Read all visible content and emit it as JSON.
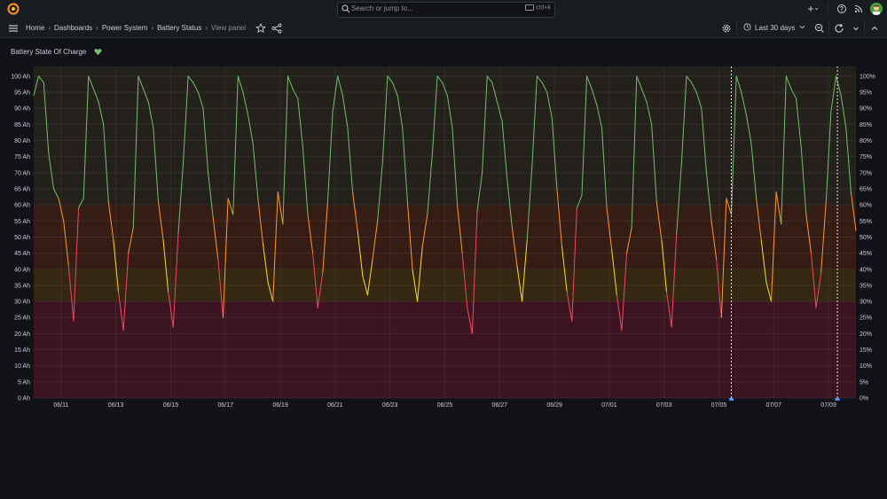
{
  "app": {
    "title": "Grafana"
  },
  "search": {
    "placeholder": "Search or jump to...",
    "shortcut": "ctrl+k"
  },
  "breadcrumb": {
    "items": [
      "Home",
      "Dashboards",
      "Power System",
      "Battery Status"
    ],
    "current": "View panel"
  },
  "toolbar": {
    "time_range": "Last 30 days"
  },
  "panel": {
    "title": "Battery State Of Charge",
    "health_icon": "heart-icon",
    "health_color": "#73bf69"
  },
  "chart_data": {
    "type": "line",
    "series": [
      {
        "values": [
          94,
          100,
          98,
          76,
          65,
          62,
          55,
          41,
          24,
          59,
          62,
          100,
          96,
          92,
          85,
          61,
          49,
          33,
          21,
          45,
          53,
          100,
          96,
          92,
          84,
          61,
          49,
          33,
          22,
          51,
          73,
          100,
          98,
          95,
          90,
          70,
          56,
          43,
          25,
          62,
          57,
          100,
          95,
          88,
          79,
          62,
          48,
          36,
          30,
          64,
          54,
          100,
          96,
          93,
          78,
          57,
          45,
          28,
          39,
          61,
          89,
          100,
          94,
          84,
          64,
          52,
          38,
          32,
          43,
          55,
          73,
          100,
          98,
          94,
          84,
          61,
          40,
          30,
          47,
          57,
          76,
          100,
          98,
          94,
          84,
          60,
          45,
          28,
          20,
          58,
          70,
          100,
          98,
          92,
          86,
          68,
          53,
          41,
          30,
          49,
          72,
          100,
          98,
          95,
          87,
          65,
          47,
          33,
          24,
          59,
          63,
          100,
          96,
          91,
          84,
          59,
          46,
          32,
          21,
          45,
          53,
          100,
          96,
          92,
          85,
          61,
          49,
          33,
          22,
          51,
          73,
          100,
          98,
          95,
          90,
          70,
          55,
          43,
          25,
          62,
          57,
          100,
          95,
          88,
          79,
          62,
          49,
          36,
          30,
          64,
          54,
          100,
          96,
          93,
          78,
          57,
          45,
          28,
          39,
          61,
          89,
          100,
          94,
          84,
          64,
          52
        ]
      }
    ],
    "x_range": [
      "06/10",
      "07/10"
    ],
    "x_ticks": [
      "06/11",
      "06/13",
      "06/15",
      "06/17",
      "06/19",
      "06/21",
      "06/23",
      "06/25",
      "06/27",
      "06/29",
      "07/01",
      "07/03",
      "07/05",
      "07/07",
      "07/09"
    ],
    "y_left_ticks": [
      "0 Ah",
      "5 Ah",
      "10 Ah",
      "15 Ah",
      "20 Ah",
      "25 Ah",
      "30 Ah",
      "35 Ah",
      "40 Ah",
      "45 Ah",
      "50 Ah",
      "55 Ah",
      "60 Ah",
      "65 Ah",
      "70 Ah",
      "75 Ah",
      "80 Ah",
      "85 Ah",
      "90 Ah",
      "95 Ah",
      "100 Ah"
    ],
    "y_right_ticks": [
      "0%",
      "5%",
      "10%",
      "15%",
      "20%",
      "25%",
      "30%",
      "35%",
      "40%",
      "45%",
      "50%",
      "55%",
      "60%",
      "65%",
      "70%",
      "75%",
      "80%",
      "85%",
      "90%",
      "95%",
      "100%"
    ],
    "ylim": [
      0,
      103
    ],
    "bands": [
      {
        "from": 0,
        "to": 30,
        "color": "#3d1422"
      },
      {
        "from": 30,
        "to": 40,
        "color": "#352712"
      },
      {
        "from": 40,
        "to": 60,
        "color": "#351c14"
      },
      {
        "from": 60,
        "to": 103,
        "color": "#24201c"
      }
    ],
    "thresholds": [
      {
        "below": 30,
        "color": "#f2495c"
      },
      {
        "below": 40,
        "color": "#fade2a"
      },
      {
        "below": 60,
        "color": "#ff9830"
      },
      {
        "below": 1000,
        "color": "#73bf69"
      }
    ],
    "annotations": [
      "07/05",
      "07/09"
    ],
    "grid": true,
    "legend": "none"
  }
}
